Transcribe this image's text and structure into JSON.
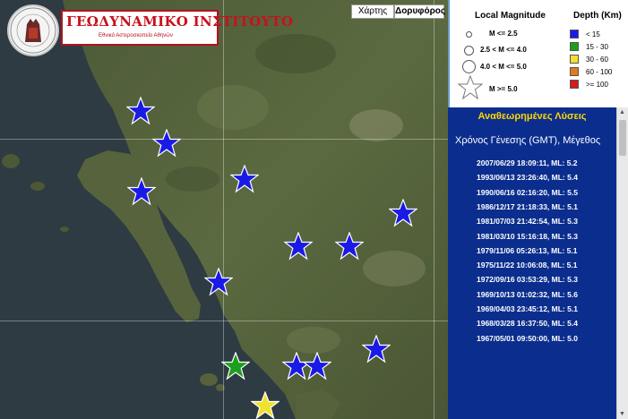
{
  "logo": {
    "title": "ΓΕΩΔΥΝΑΜΙΚΟ ΙΝΣΤΙΤΟΥΤΟ",
    "subtitle": "Εθνικό Αστεροσκοπείο Αθηνών"
  },
  "map_type": {
    "map_label": "Χάρτης",
    "satellite_label": "Δορυφόρος",
    "selected": "satellite"
  },
  "legend": {
    "magnitude_title": "Local Magnitude",
    "depth_title": "Depth (Km)",
    "magnitude_items": [
      "M <= 2.5",
      "2.5 < M <= 4.0",
      "4.0 < M <= 5.0",
      "M >= 5.0"
    ],
    "depth_items": [
      {
        "label": "< 15",
        "color": "#1a1ae6"
      },
      {
        "label": "15 - 30",
        "color": "#1e9e1e"
      },
      {
        "label": "30 - 60",
        "color": "#f0e030"
      },
      {
        "label": "60 - 100",
        "color": "#e07a20"
      },
      {
        "label": ">= 100",
        "color": "#d81a1a"
      }
    ]
  },
  "solutions": {
    "header": "Αναθεωρημένες Λύσεις",
    "subheader": "Χρόνος Γένεσης (GMT),  Μέγεθος",
    "events": [
      "2007/06/29 18:09:11,  ML: 5.2",
      "1993/06/13 23:26:40,  ML: 5.4",
      "1990/06/16 02:16:20,  ML: 5.5",
      "1986/12/17 21:18:33,  ML: 5.1",
      "1981/07/03 21:42:54,  ML: 5.3",
      "1981/03/10 15:16:18,  ML: 5.3",
      "1979/11/06 05:26:13,  ML: 5.1",
      "1975/11/22 10:06:08,  ML: 5.1",
      "1972/09/16 03:53:29,  ML: 5.3",
      "1969/10/13 01:02:32,  ML: 5.6",
      "1969/04/03 23:45:12,  ML: 5.1",
      "1968/03/28 16:37:50,  ML: 5.4",
      "1967/05/01 09:50:00,  ML: 5.0"
    ]
  },
  "epicenters": [
    {
      "depth_class": "< 15",
      "color": "#1a1ae6"
    },
    {
      "depth_class": "< 15",
      "color": "#1a1ae6"
    },
    {
      "depth_class": "< 15",
      "color": "#1a1ae6"
    },
    {
      "depth_class": "< 15",
      "color": "#1a1ae6"
    },
    {
      "depth_class": "< 15",
      "color": "#1a1ae6"
    },
    {
      "depth_class": "< 15",
      "color": "#1a1ae6"
    },
    {
      "depth_class": "< 15",
      "color": "#1a1ae6"
    },
    {
      "depth_class": "< 15",
      "color": "#1a1ae6"
    },
    {
      "depth_class": "< 15",
      "color": "#1a1ae6"
    },
    {
      "depth_class": "< 15",
      "color": "#1a1ae6"
    },
    {
      "depth_class": "< 15",
      "color": "#1a1ae6"
    },
    {
      "depth_class": "15 - 30",
      "color": "#1e9e1e"
    },
    {
      "depth_class": "30 - 60",
      "color": "#f0e030"
    }
  ]
}
